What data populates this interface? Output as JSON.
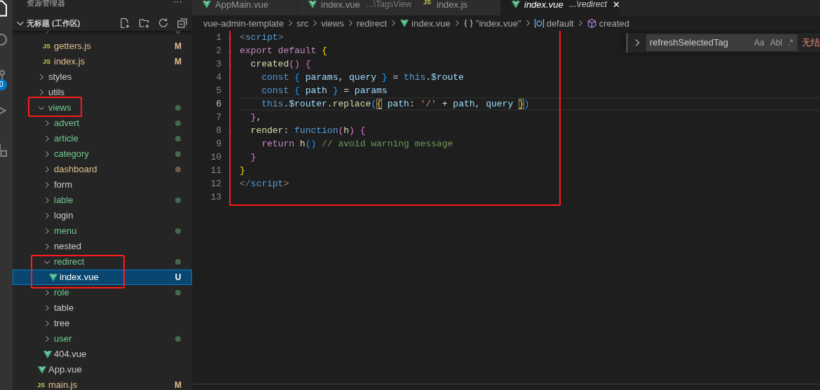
{
  "activity_bar": {
    "badge": "0"
  },
  "sidebar": {
    "title": "资源管理器",
    "more": "···",
    "workspace": {
      "title": "无标题 (工作区)",
      "expanded": true
    },
    "tree": [
      {
        "kind": "group",
        "children": [
          {
            "kind": "folder",
            "expanded": false,
            "selected": false,
            "dot": true
          },
          {
            "name": "getters.js",
            "kind": "js-file",
            "icon_label": "JS",
            "selected": false,
            "color": "#e2c08d",
            "decoration": "M"
          },
          {
            "name": "index.js",
            "kind": "js-file",
            "icon_label": "JS",
            "selected": false,
            "color": "#e2c08d",
            "decoration": "M"
          }
        ]
      },
      {
        "name": "styles",
        "kind": "folder",
        "expanded": false,
        "selected": false,
        "color": "#cccccc"
      },
      {
        "name": "utils",
        "kind": "folder",
        "expanded": false,
        "selected": false,
        "color": "#cccccc"
      },
      {
        "name": "views",
        "kind": "folder",
        "expanded": true,
        "selected": false,
        "color": "#73c991",
        "dot": true,
        "framed": true,
        "children": [
          {
            "name": "advert",
            "kind": "folder",
            "expanded": false,
            "selected": false,
            "color": "#73c991",
            "dot": true
          },
          {
            "name": "article",
            "kind": "folder",
            "expanded": false,
            "selected": false,
            "color": "#73c991",
            "dot": true
          },
          {
            "name": "category",
            "kind": "folder",
            "expanded": false,
            "selected": false,
            "color": "#73c991",
            "dot": true
          },
          {
            "name": "dashboard",
            "kind": "folder",
            "expanded": false,
            "selected": false,
            "color": "#e2c08d",
            "dot": true
          },
          {
            "name": "form",
            "kind": "folder",
            "expanded": false,
            "selected": false,
            "color": "#cccccc"
          },
          {
            "name": "lable",
            "kind": "folder",
            "expanded": false,
            "selected": false,
            "color": "#73c991",
            "dot": true
          },
          {
            "name": "login",
            "kind": "folder",
            "expanded": false,
            "selected": false,
            "color": "#cccccc"
          },
          {
            "name": "menu",
            "kind": "folder",
            "expanded": false,
            "selected": false,
            "color": "#73c991",
            "dot": true
          },
          {
            "name": "nested",
            "kind": "folder",
            "expanded": false,
            "selected": false,
            "color": "#cccccc"
          },
          {
            "name": "redirect",
            "kind": "folder",
            "expanded": true,
            "selected": false,
            "color": "#73c991",
            "dot": true,
            "framed": true,
            "framed_with_children": true,
            "children": [
              {
                "name": "index.vue",
                "kind": "vue-file",
                "selected": true,
                "decoration": "U"
              }
            ]
          },
          {
            "name": "role",
            "kind": "folder",
            "expanded": false,
            "selected": false,
            "color": "#73c991",
            "dot": true
          },
          {
            "name": "table",
            "kind": "folder",
            "expanded": false,
            "selected": false,
            "color": "#cccccc"
          },
          {
            "name": "tree",
            "kind": "folder",
            "expanded": false,
            "selected": false,
            "color": "#cccccc"
          },
          {
            "name": "user",
            "kind": "folder",
            "expanded": false,
            "selected": false,
            "color": "#73c991",
            "dot": true
          },
          {
            "name": "404.vue",
            "kind": "vue-file",
            "selected": false,
            "color": "#cccccc"
          }
        ]
      },
      {
        "name": "App.vue",
        "kind": "vue-file",
        "selected": false,
        "color": "#cccccc"
      },
      {
        "name": "main.js",
        "kind": "js-file",
        "icon_label": "JS",
        "selected": false,
        "color": "#e2c08d",
        "decoration": "M"
      }
    ]
  },
  "tabs": [
    {
      "label": "AppMain.vue",
      "kind": "vue",
      "selected": false
    },
    {
      "label": "index.vue",
      "description": "...\\TagsView",
      "kind": "vue",
      "selected": false
    },
    {
      "label": "index.js",
      "kind": "js",
      "icon_label": "JS",
      "selected": false
    },
    {
      "label": "index.vue",
      "description": "...\\redirect",
      "kind": "vue",
      "selected": true,
      "close": "✕"
    }
  ],
  "breadcrumb": [
    {
      "label": "vue-admin-template",
      "kind": "folder"
    },
    {
      "label": "src",
      "kind": "folder"
    },
    {
      "label": "views",
      "kind": "folder"
    },
    {
      "label": "redirect",
      "kind": "folder"
    },
    {
      "label": "index.vue",
      "kind": "vue"
    },
    {
      "label": "\"index.vue\"",
      "kind": "braces"
    },
    {
      "label": "default",
      "kind": "module"
    },
    {
      "label": "created",
      "kind": "method"
    }
  ],
  "find": {
    "value": "refreshSelectedTag",
    "options": [
      "Aa",
      "Abl",
      ".*"
    ],
    "result": "无结"
  },
  "editor": {
    "framed": true,
    "lines": [
      {
        "number": "1",
        "foldable": true,
        "current": false,
        "tokens": [
          {
            "t": "<",
            "kind": "punct"
          },
          {
            "t": "script",
            "kind": "tag"
          },
          {
            "t": ">",
            "kind": "punct"
          }
        ]
      },
      {
        "number": "2",
        "foldable": true,
        "current": false,
        "tokens": [
          {
            "t": "export",
            "kind": "keyword"
          },
          {
            "t": " default",
            "kind": "keyword"
          },
          {
            "t": " {",
            "kind": "bracket1"
          }
        ]
      },
      {
        "number": "3",
        "foldable": true,
        "current": false,
        "tokens": [
          {
            "t": "  created",
            "kind": "function"
          },
          {
            "t": "()",
            "kind": "bracket2"
          },
          {
            "t": " {",
            "kind": "bracket2"
          }
        ]
      },
      {
        "number": "4",
        "foldable": false,
        "current": false,
        "tokens": [
          {
            "t": "    const",
            "kind": "storage"
          },
          {
            "t": " {",
            "kind": "bracket3"
          },
          {
            "t": " params",
            "kind": "variable"
          },
          {
            "t": ",",
            "kind": "plain"
          },
          {
            "t": " query",
            "kind": "variable"
          },
          {
            "t": " }",
            "kind": "bracket3"
          },
          {
            "t": " =",
            "kind": "plain"
          },
          {
            "t": " this",
            "kind": "storage"
          },
          {
            "t": ".",
            "kind": "plain"
          },
          {
            "t": "$route",
            "kind": "variable"
          }
        ]
      },
      {
        "number": "5",
        "foldable": false,
        "current": false,
        "tokens": [
          {
            "t": "    const",
            "kind": "storage"
          },
          {
            "t": " {",
            "kind": "bracket3"
          },
          {
            "t": " path",
            "kind": "variable"
          },
          {
            "t": " }",
            "kind": "bracket3"
          },
          {
            "t": " =",
            "kind": "plain"
          },
          {
            "t": " params",
            "kind": "variable"
          }
        ]
      },
      {
        "number": "6",
        "foldable": false,
        "current": true,
        "tokens": [
          {
            "t": "    this",
            "kind": "storage"
          },
          {
            "t": ".",
            "kind": "plain"
          },
          {
            "t": "$router",
            "kind": "variable"
          },
          {
            "t": ".",
            "kind": "plain"
          },
          {
            "t": "replace",
            "kind": "function"
          },
          {
            "t": "(",
            "kind": "bracket3"
          },
          {
            "t": "{",
            "kind": "bracket-match"
          },
          {
            "t": " path",
            "kind": "variable"
          },
          {
            "t": ":",
            "kind": "plain"
          },
          {
            "t": " '/'",
            "kind": "string"
          },
          {
            "t": " +",
            "kind": "plain"
          },
          {
            "t": " path",
            "kind": "variable"
          },
          {
            "t": ",",
            "kind": "plain"
          },
          {
            "t": " query ",
            "kind": "variable"
          },
          {
            "t": "}",
            "kind": "bracket-match"
          },
          {
            "t": ")",
            "kind": "bracket3"
          }
        ]
      },
      {
        "number": "7",
        "foldable": false,
        "current": false,
        "tokens": [
          {
            "t": "  }",
            "kind": "bracket2"
          },
          {
            "t": ",",
            "kind": "plain"
          }
        ]
      },
      {
        "number": "8",
        "foldable": true,
        "current": false,
        "tokens": [
          {
            "t": "  render",
            "kind": "function"
          },
          {
            "t": ":",
            "kind": "plain"
          },
          {
            "t": " function",
            "kind": "storage"
          },
          {
            "t": "(",
            "kind": "bracket2"
          },
          {
            "t": "h",
            "kind": "function"
          },
          {
            "t": ")",
            "kind": "bracket2"
          },
          {
            "t": " {",
            "kind": "bracket2"
          }
        ]
      },
      {
        "number": "9",
        "foldable": false,
        "current": false,
        "tokens": [
          {
            "t": "    return",
            "kind": "keyword"
          },
          {
            "t": " h",
            "kind": "function"
          },
          {
            "t": "()",
            "kind": "bracket3"
          },
          {
            "t": " // avoid warning message",
            "kind": "comment"
          }
        ]
      },
      {
        "number": "10",
        "foldable": false,
        "current": false,
        "tokens": [
          {
            "t": "  }",
            "kind": "bracket2"
          }
        ]
      },
      {
        "number": "11",
        "foldable": false,
        "current": false,
        "tokens": [
          {
            "t": "}",
            "kind": "bracket1"
          }
        ]
      },
      {
        "number": "12",
        "foldable": false,
        "current": false,
        "tokens": [
          {
            "t": "</",
            "kind": "punct"
          },
          {
            "t": "script",
            "kind": "tag"
          },
          {
            "t": ">",
            "kind": "punct"
          }
        ]
      },
      {
        "number": "13",
        "foldable": false,
        "current": false
      }
    ]
  }
}
